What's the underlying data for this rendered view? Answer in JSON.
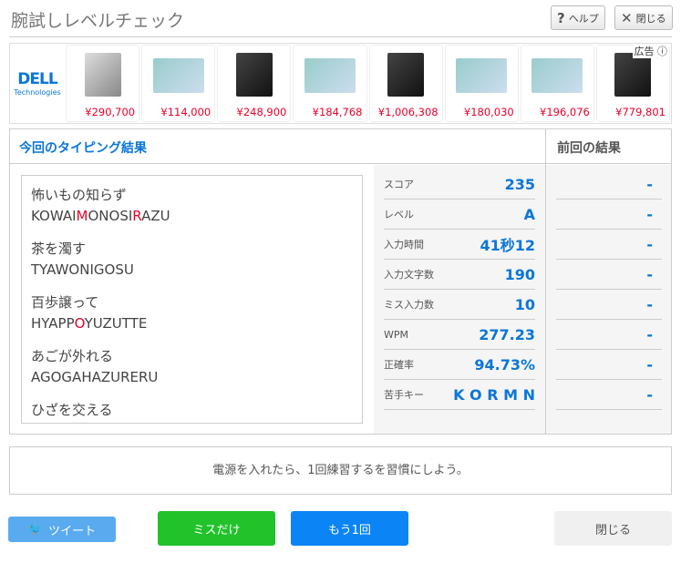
{
  "header": {
    "title": "腕試しレベルチェック",
    "help": "ヘルプ",
    "close": "閉じる"
  },
  "ad": {
    "label": "広告",
    "brand": "DELL",
    "brand_sub": "Technologies",
    "prices": [
      "¥290,700",
      "¥114,000",
      "¥248,900",
      "¥184,768",
      "¥1,006,308",
      "¥180,030",
      "¥196,076",
      "¥779,801"
    ]
  },
  "results": {
    "current_title": "今回のタイピング結果",
    "previous_title": "前回の結果",
    "words": [
      {
        "jp": "怖いもの知らず",
        "parts": [
          [
            "KOWAI",
            0
          ],
          [
            "M",
            1
          ],
          [
            "ONOSI",
            0
          ],
          [
            "R",
            1
          ],
          [
            "AZU",
            0
          ]
        ]
      },
      {
        "jp": "茶を濁す",
        "parts": [
          [
            "TYAWONIGOSU",
            0
          ]
        ]
      },
      {
        "jp": "百歩譲って",
        "parts": [
          [
            "HYAPP",
            0
          ],
          [
            "O",
            1
          ],
          [
            "YUZUTTE",
            0
          ]
        ]
      },
      {
        "jp": "あごが外れる",
        "parts": [
          [
            "AGOGAHAZURERU",
            0
          ]
        ]
      },
      {
        "jp": "ひざを交える",
        "parts": []
      }
    ],
    "stats": [
      {
        "label": "スコア",
        "value": "235",
        "prev": "-"
      },
      {
        "label": "レベル",
        "value": "A",
        "prev": "-"
      },
      {
        "label": "入力時間",
        "value": "41秒12",
        "prev": "-"
      },
      {
        "label": "入力文字数",
        "value": "190",
        "prev": "-"
      },
      {
        "label": "ミス入力数",
        "value": "10",
        "prev": "-"
      },
      {
        "label": "WPM",
        "value": "277.23",
        "prev": "-"
      },
      {
        "label": "正確率",
        "value": "94.73%",
        "prev": "-"
      },
      {
        "label": "苦手キー",
        "value": "K O R M N",
        "prev": "-"
      }
    ]
  },
  "message": "電源を入れたら、1回練習するを習慣にしよう。",
  "buttons": {
    "tweet": "ツイート",
    "miss_only": "ミスだけ",
    "retry": "もう1回",
    "close": "閉じる"
  }
}
